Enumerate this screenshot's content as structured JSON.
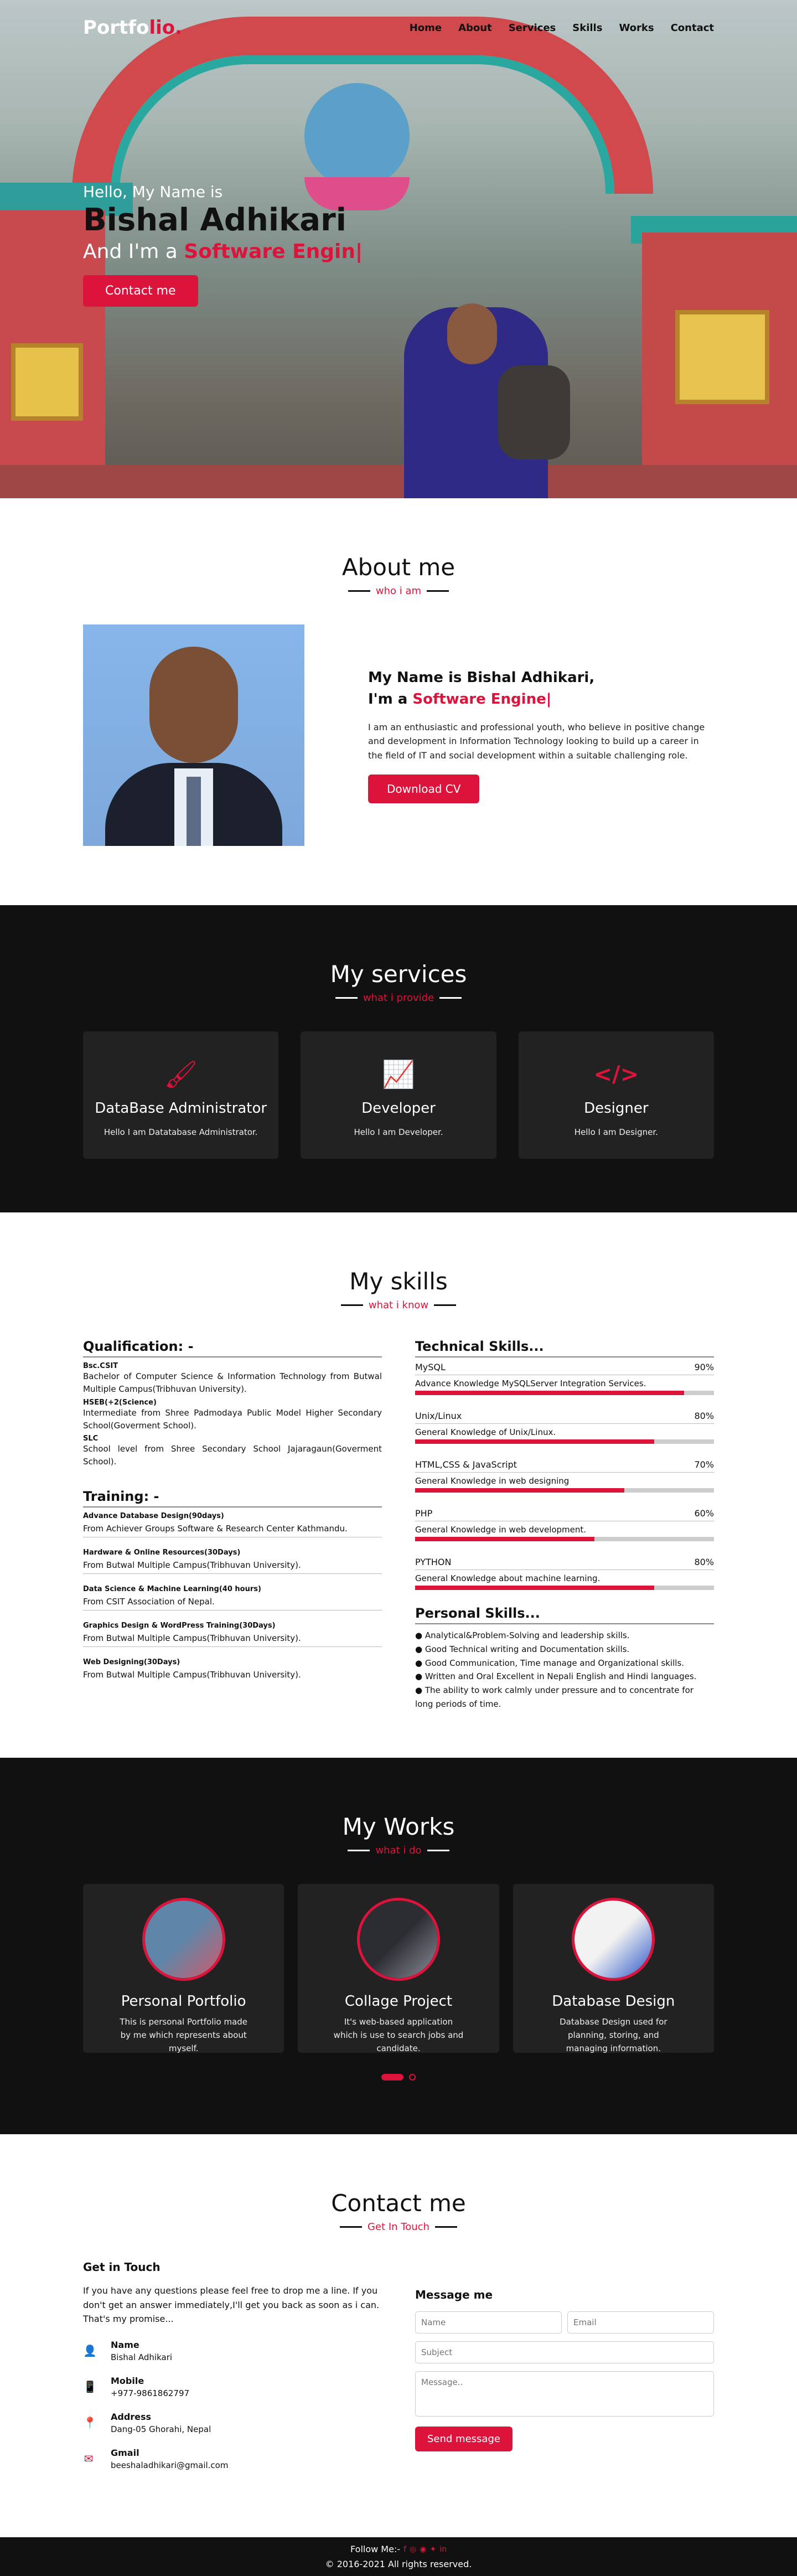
{
  "nav": {
    "logo_main": "Portfo",
    "logo_accent": "lio.",
    "items": [
      "Home",
      "About",
      "Services",
      "Skills",
      "Works",
      "Contact"
    ]
  },
  "hero": {
    "hello": "Hello, My Name is",
    "name": "Bishal Adhikari",
    "role_prefix": "And I'm a ",
    "role_typed": "Software Engin|",
    "cta": "Contact me"
  },
  "about": {
    "title": "About me",
    "subtitle": "who i am",
    "heading_line1": "My Name is Bishal Adhikari,",
    "heading_prefix": "I'm a ",
    "heading_typed": "Software Engine|",
    "paragraph": "I am an enthusiastic and professional youth, who believe in positive change and development in Information Technology looking to build up a career in the field of IT and social development within a suitable challenging role.",
    "button": "Download CV"
  },
  "services": {
    "title": "My services",
    "subtitle": "what i provide",
    "items": [
      {
        "icon": "brush-icon",
        "glyph": "🖌",
        "title": "DataBase Administrator",
        "desc": "Hello I am Datatabase Administrator."
      },
      {
        "icon": "chart-line-icon",
        "glyph": "📈",
        "title": "Developer",
        "desc": "Hello I am Developer."
      },
      {
        "icon": "code-icon",
        "glyph": "</>",
        "title": "Designer",
        "desc": "Hello I am Designer."
      }
    ]
  },
  "skills": {
    "title": "My skills",
    "subtitle": "what i know",
    "qualification_heading": "Qualification: -",
    "qualifications": [
      {
        "title": "Bsc.CSIT",
        "desc": "Bachelor of Computer Science & Information Technology from Butwal Multiple Campus(Tribhuvan University)."
      },
      {
        "title": "HSEB(+2(Science)",
        "desc": "Intermediate from Shree Padmodaya Public Model Higher Secondary School(Goverment School)."
      },
      {
        "title": "SLC",
        "desc": "School level from Shree Secondary School Jajaragaun(Goverment School)."
      }
    ],
    "training_heading": "Training: -",
    "trainings": [
      {
        "title": "Advance Database Design(90days)",
        "desc": "From Achiever Groups Software & Research Center Kathmandu."
      },
      {
        "title": "Hardware & Online Resources(30Days)",
        "desc": "From Butwal Multiple Campus(Tribhuvan University)."
      },
      {
        "title": "Data Science & Machine Learning(40 hours)",
        "desc": "From CSIT Association of Nepal."
      },
      {
        "title": "Graphics Design & WordPress Training(30Days)",
        "desc": "From Butwal Multiple Campus(Tribhuvan University)."
      },
      {
        "title": "Web Designing(30Days)",
        "desc": "From Butwal Multiple Campus(Tribhuvan University)."
      }
    ],
    "technical_heading": "Technical Skills...",
    "technical": [
      {
        "name": "MySQL",
        "percent_label": "90%",
        "level": 90,
        "desc": "Advance Knowledge MySQLServer Integration Services."
      },
      {
        "name": "Unix/Linux",
        "percent_label": "80%",
        "level": 80,
        "desc": "General Knowledge of Unix/Linux."
      },
      {
        "name": "HTML,CSS & JavaScript",
        "percent_label": "70%",
        "level": 70,
        "desc": "General Knowledge in web designing"
      },
      {
        "name": "PHP",
        "percent_label": "60%",
        "level": 60,
        "desc": "General Knowledge in web development."
      },
      {
        "name": "PYTHON",
        "percent_label": "80%",
        "level": 80,
        "desc": "General Knowledge about machine learning."
      }
    ],
    "personal_heading": "Personal Skills...",
    "personal": [
      "● Analytical&Problem-Solving and leadership skills.",
      "● Good Technical writing and Documentation skills.",
      "● Good Communication, Time manage and Organizational skills.",
      "● Written and Oral Excellent in Nepali English and Hindi languages.",
      "● The ability to work calmly under pressure and to concentrate for long periods of time."
    ]
  },
  "works": {
    "title": "My Works",
    "subtitle": "what i do",
    "items": [
      {
        "title": "Personal Portfolio",
        "desc": "This is personal Portfolio made by me which represents about myself.",
        "thumb_color": "#5f86a8",
        "thumb_color2": "#d35a6a"
      },
      {
        "title": "Collage Project",
        "desc": "It's web-based application which is use to search jobs and candidate.",
        "thumb_color": "#2c2c33",
        "thumb_color2": "#8b8f98"
      },
      {
        "title": "Database Design",
        "desc": "Database Design used for planning, storing, and managing information.",
        "thumb_color": "#f2f2f2",
        "thumb_color2": "#2a55c8"
      }
    ]
  },
  "contact": {
    "title": "Contact me",
    "subtitle": "Get In Touch",
    "left_heading": "Get in Touch",
    "intro": "If you have any questions please feel free to drop me a line. If you don't get an answer immediately,I'll get you back as soon as i can. That's my promise...",
    "info": [
      {
        "icon": "user-icon",
        "glyph": "👤",
        "title": "Name",
        "value": "Bishal Adhikari"
      },
      {
        "icon": "mobile-icon",
        "glyph": "📱",
        "title": "Mobile",
        "value": "+977-9861862797"
      },
      {
        "icon": "map-marker-icon",
        "glyph": "📍",
        "title": "Address",
        "value": "Dang-05 Ghorahi, Nepal"
      },
      {
        "icon": "envelope-icon",
        "glyph": "✉",
        "title": "Gmail",
        "value": "beeshaladhikari@gmail.com"
      }
    ],
    "form_heading": "Message me",
    "name_placeholder": "Name",
    "email_placeholder": "Email",
    "subject_placeholder": "Subject",
    "message_placeholder": "Message..",
    "send": "Send message"
  },
  "footer": {
    "follow": "Follow Me:-",
    "social": [
      "f",
      "◎",
      "◉",
      "✦",
      "in"
    ],
    "copyright": "© 2016-2021 All rights reserved."
  },
  "colors": {
    "accent": "#dc143c",
    "dark": "#111111",
    "card": "#222222"
  }
}
